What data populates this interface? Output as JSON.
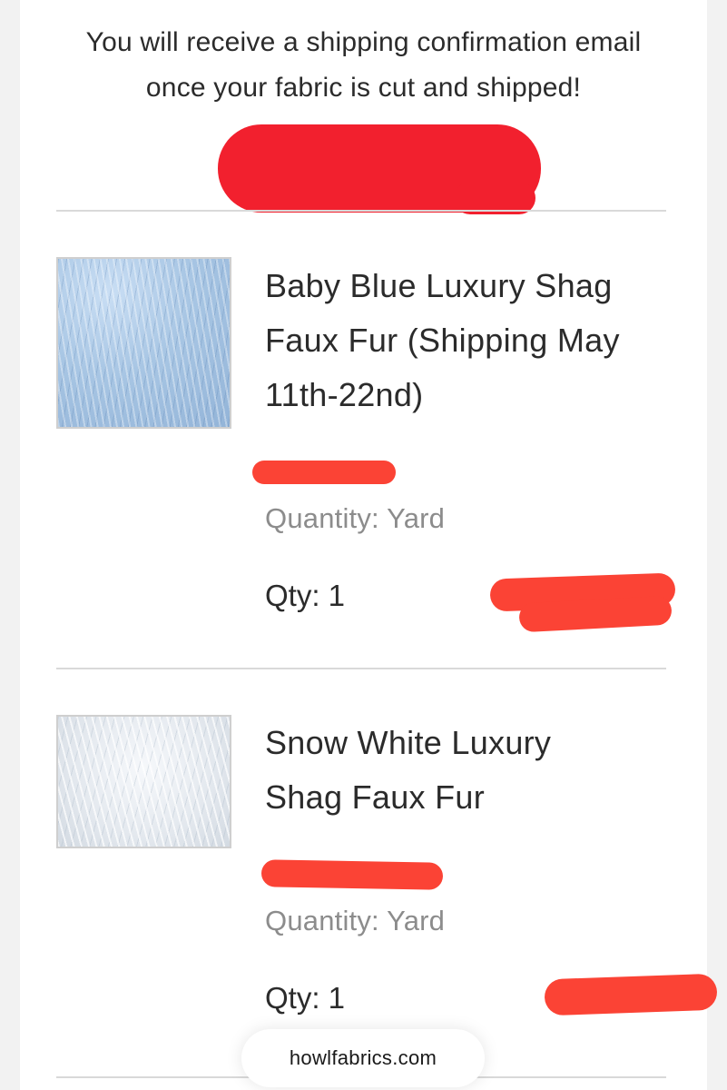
{
  "intro": {
    "line1": "You will receive a shipping confirmation email",
    "line2": "once your fabric is cut and shipped!"
  },
  "items": [
    {
      "title_lines": [
        "Baby Blue Luxury Shag",
        "Faux Fur (Shipping May",
        "11th-22nd)"
      ],
      "variant": "Quantity: Yard",
      "qty": "Qty: 1",
      "thumb_icon": "baby-blue-fur-swatch"
    },
    {
      "title_lines": [
        "Snow White Luxury",
        "Shag Faux Fur"
      ],
      "variant": "Quantity: Yard",
      "qty": "Qty: 1",
      "thumb_icon": "snow-white-fur-swatch"
    }
  ],
  "footer": {
    "domain": "howlfabrics.com"
  },
  "colors": {
    "redaction": "#f21f2d",
    "redaction_light": "#fb4335",
    "divider": "#d9d9d9",
    "text": "#2b2b2b",
    "muted_text": "#8c8c8c"
  }
}
